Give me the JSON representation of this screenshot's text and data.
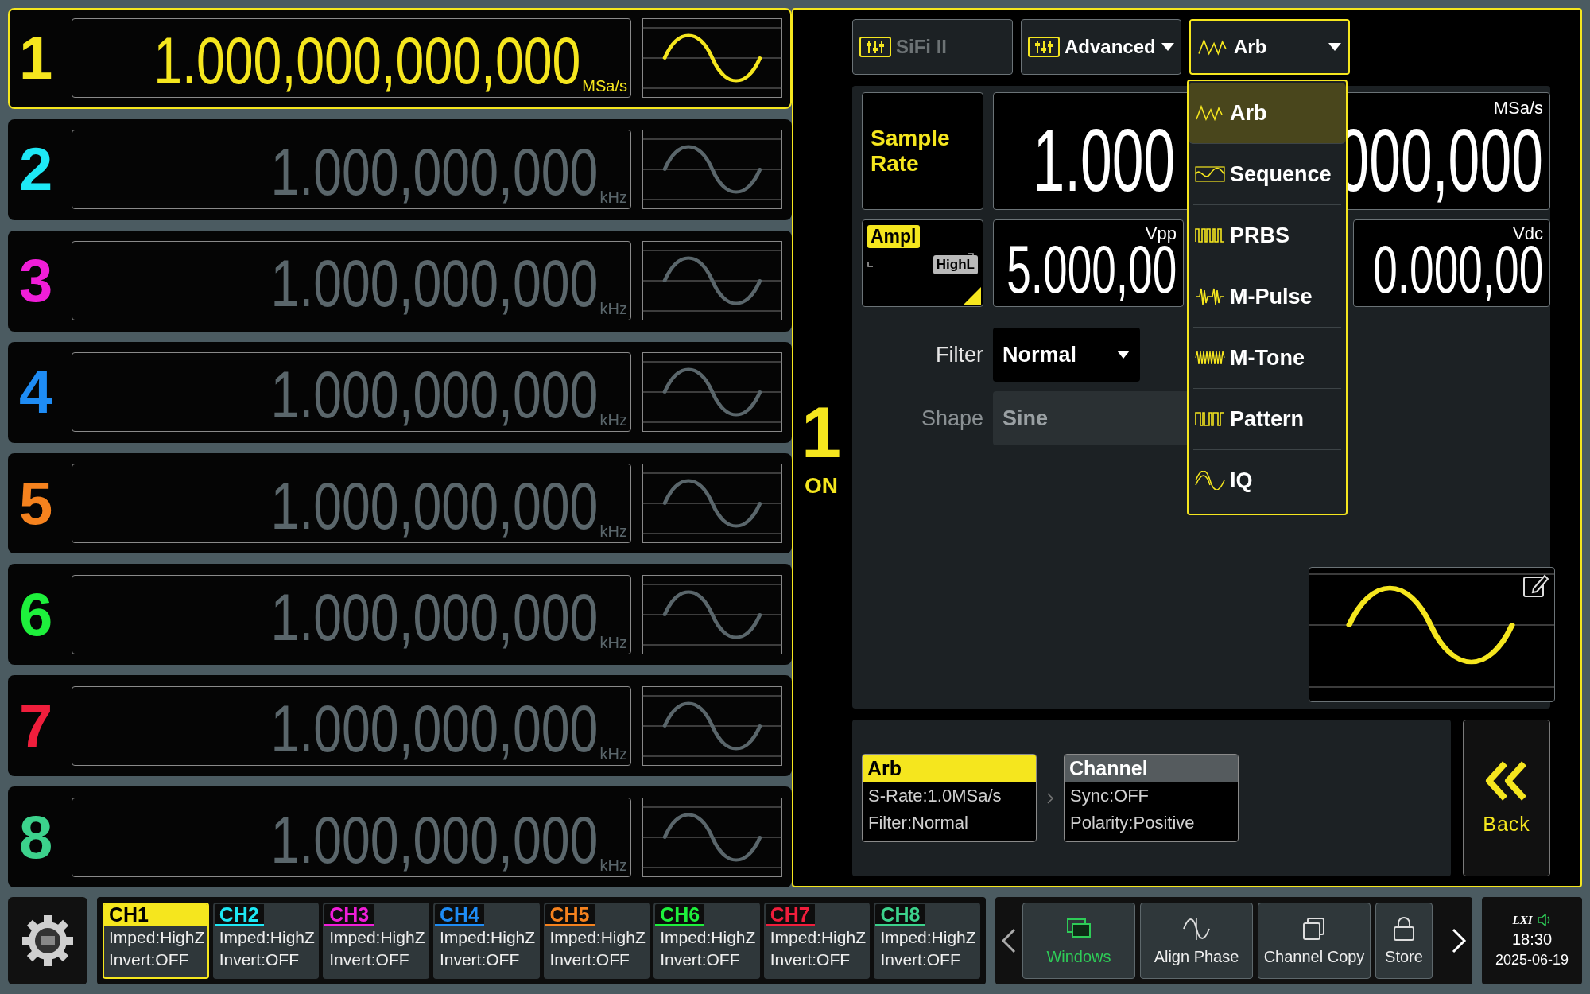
{
  "channels": [
    {
      "number": "1",
      "value": "1.000,000,000,000",
      "unit": "MSa/s",
      "color": "#f5e61e",
      "selected": true
    },
    {
      "number": "2",
      "value": "1.000,000,000",
      "unit": "kHz",
      "color": "#1ee8f5",
      "selected": false
    },
    {
      "number": "3",
      "value": "1.000,000,000",
      "unit": "kHz",
      "color": "#f01ed8",
      "selected": false
    },
    {
      "number": "4",
      "value": "1.000,000,000",
      "unit": "kHz",
      "color": "#1e8cf5",
      "selected": false
    },
    {
      "number": "5",
      "value": "1.000,000,000",
      "unit": "kHz",
      "color": "#f5821e",
      "selected": false
    },
    {
      "number": "6",
      "value": "1.000,000,000",
      "unit": "kHz",
      "color": "#1ef03c",
      "selected": false
    },
    {
      "number": "7",
      "value": "1.000,000,000",
      "unit": "kHz",
      "color": "#f01e3c",
      "selected": false
    },
    {
      "number": "8",
      "value": "1.000,000,000",
      "unit": "kHz",
      "color": "#3cd28c",
      "selected": false
    }
  ],
  "active_channel": {
    "number": "1",
    "state": "ON"
  },
  "mode_buttons": [
    {
      "label": "SiFi II",
      "disabled": true,
      "dropdown": false,
      "open": false
    },
    {
      "label": "Advanced",
      "disabled": false,
      "dropdown": true,
      "open": false
    },
    {
      "label": "Arb",
      "disabled": false,
      "dropdown": true,
      "open": true
    }
  ],
  "sample_rate": {
    "label": "Sample Rate",
    "selected": true,
    "value_start": "1.000",
    "value_end": "000,000",
    "unit": "MSa/s"
  },
  "amplitude": {
    "label": "Ampl",
    "badge": "HighL",
    "value": "5.000,00",
    "unit": "Vpp"
  },
  "offset": {
    "value": "0.000,00",
    "unit": "Vdc"
  },
  "filter": {
    "label": "Filter",
    "value": "Normal",
    "disabled": false
  },
  "shape": {
    "label": "Shape",
    "value": "Sine",
    "disabled": true
  },
  "wave_menu": [
    {
      "label": "Arb",
      "selected": true
    },
    {
      "label": "Sequence",
      "selected": false
    },
    {
      "label": "PRBS",
      "selected": false
    },
    {
      "label": "M-Pulse",
      "selected": false
    },
    {
      "label": "M-Tone",
      "selected": false
    },
    {
      "label": "Pattern",
      "selected": false
    },
    {
      "label": "IQ",
      "selected": false
    }
  ],
  "config_cards": [
    {
      "title": "Arb",
      "lines": [
        "S-Rate:1.0MSa/s",
        "Filter:Normal"
      ],
      "selected": true
    },
    {
      "title": "Channel",
      "lines": [
        "Sync:OFF",
        "Polarity:Positive"
      ],
      "selected": false
    }
  ],
  "back_button": "Back",
  "channel_tabs": [
    {
      "label": "CH1",
      "impedance": "Imped:HighZ",
      "invert": "Invert:OFF",
      "color": "#f5e61e",
      "selected": true
    },
    {
      "label": "CH2",
      "impedance": "Imped:HighZ",
      "invert": "Invert:OFF",
      "color": "#1ee8f5",
      "selected": false
    },
    {
      "label": "CH3",
      "impedance": "Imped:HighZ",
      "invert": "Invert:OFF",
      "color": "#f01ed8",
      "selected": false
    },
    {
      "label": "CH4",
      "impedance": "Imped:HighZ",
      "invert": "Invert:OFF",
      "color": "#1e8cf5",
      "selected": false
    },
    {
      "label": "CH5",
      "impedance": "Imped:HighZ",
      "invert": "Invert:OFF",
      "color": "#f5821e",
      "selected": false
    },
    {
      "label": "CH6",
      "impedance": "Imped:HighZ",
      "invert": "Invert:OFF",
      "color": "#1ef03c",
      "selected": false
    },
    {
      "label": "CH7",
      "impedance": "Imped:HighZ",
      "invert": "Invert:OFF",
      "color": "#f01e3c",
      "selected": false
    },
    {
      "label": "CH8",
      "impedance": "Imped:HighZ",
      "invert": "Invert:OFF",
      "color": "#3cd28c",
      "selected": false
    }
  ],
  "softkeys": [
    {
      "label": "Windows",
      "on": true
    },
    {
      "label": "Align Phase",
      "on": false
    },
    {
      "label": "Channel Copy",
      "on": false
    },
    {
      "label": "Store",
      "on": false
    }
  ],
  "status": {
    "logo": "LXI",
    "time": "18:30",
    "date": "2025-06-19"
  }
}
